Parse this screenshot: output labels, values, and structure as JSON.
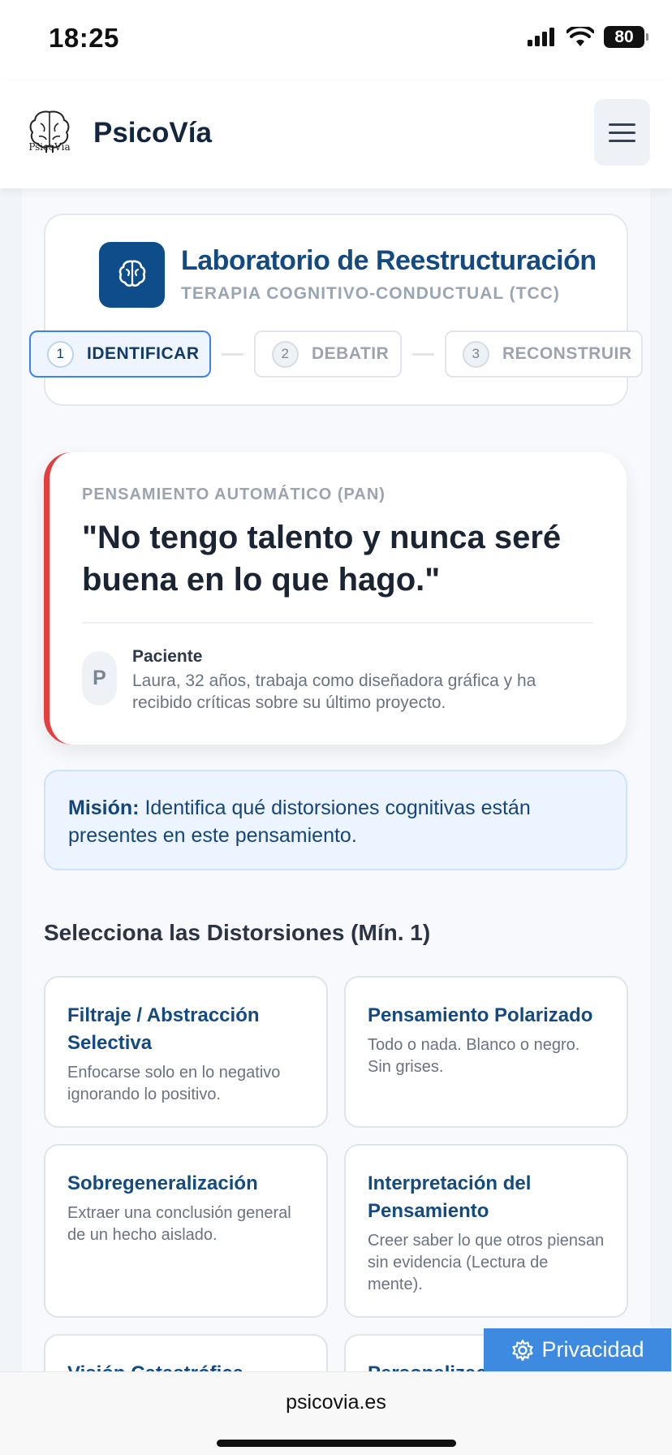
{
  "status_bar": {
    "time": "18:25",
    "battery": "80"
  },
  "header": {
    "logo_caption": "PsicoVía",
    "brand": "PsicoVía"
  },
  "lab": {
    "title": "Laboratorio de Reestructuración",
    "subtitle": "TERAPIA COGNITIVO-CONDUCTUAL (TCC)",
    "steps": [
      {
        "num": "1",
        "label": "IDENTIFICAR",
        "active": true
      },
      {
        "num": "2",
        "label": "DEBATIR",
        "active": false
      },
      {
        "num": "3",
        "label": "RECONSTRUIR",
        "active": false
      }
    ]
  },
  "thought": {
    "label": "PENSAMIENTO AUTOMÁTICO (PAN)",
    "quote": "\"No tengo talento y nunca seré buena en lo que hago.\"",
    "patient_initial": "P",
    "patient_title": "Paciente",
    "patient_desc": "Laura, 32 años, trabaja como diseñadora gráfica y ha recibido críticas sobre su último proyecto."
  },
  "mission": {
    "label": "Misión:",
    "text": "Identifica qué distorsiones cognitivas están presentes en este pensamiento."
  },
  "distortions": {
    "heading": "Selecciona las Distorsiones (Mín. 1)",
    "items": [
      {
        "title": "Filtraje / Abstracción Selectiva",
        "desc": "Enfocarse solo en lo negativo ignorando lo positivo."
      },
      {
        "title": "Pensamiento Polarizado",
        "desc": "Todo o nada. Blanco o negro. Sin grises."
      },
      {
        "title": "Sobregeneralización",
        "desc": "Extraer una conclusión general de un hecho aislado."
      },
      {
        "title": "Interpretación del Pensamiento",
        "desc": "Creer saber lo que otros piensan sin evidencia (Lectura de mente)."
      },
      {
        "title": "Visión Catastrófica",
        "desc": ""
      },
      {
        "title": "Personalización",
        "desc": ""
      }
    ]
  },
  "privacy": {
    "label": "Privacidad"
  },
  "browser": {
    "url": "psicovia.es"
  },
  "colors": {
    "accent": "#0f4c8a",
    "alert": "#e53e3e",
    "privacy": "#3d8ae0"
  }
}
